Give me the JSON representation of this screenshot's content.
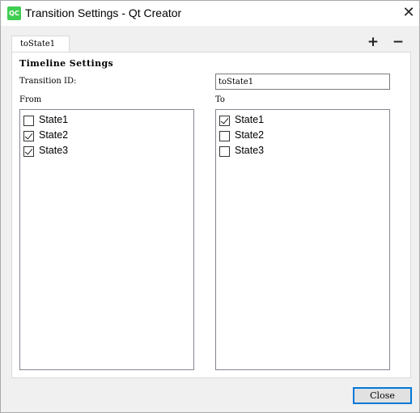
{
  "window": {
    "title": "Transition Settings - Qt Creator",
    "app_icon_text": "QC",
    "close_glyph": "✕"
  },
  "tabs": {
    "items": [
      {
        "label": "toState1"
      }
    ],
    "add_glyph": "+",
    "remove_glyph": "−"
  },
  "settings": {
    "heading": "Timeline Settings",
    "transition_id_label": "Transition ID:",
    "transition_id_value": "toState1",
    "from_label": "From",
    "to_label": "To"
  },
  "from_states": [
    {
      "label": "State1",
      "checked": false
    },
    {
      "label": "State2",
      "checked": true
    },
    {
      "label": "State3",
      "checked": true
    }
  ],
  "to_states": [
    {
      "label": "State1",
      "checked": true
    },
    {
      "label": "State2",
      "checked": false
    },
    {
      "label": "State3",
      "checked": false
    }
  ],
  "footer": {
    "close_label": "Close"
  },
  "colors": {
    "accent": "#0078d7",
    "app_icon": "#41cd52"
  }
}
